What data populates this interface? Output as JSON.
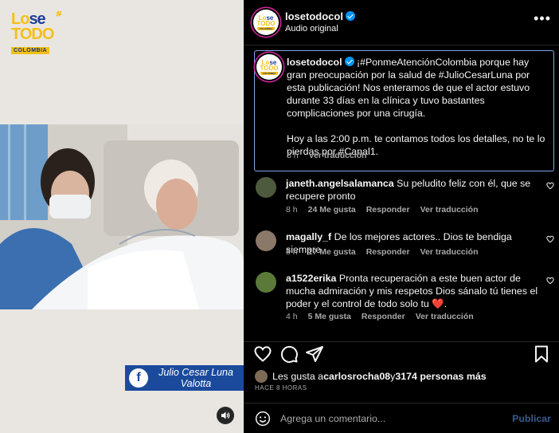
{
  "media": {
    "logo": {
      "lo": "Lo",
      "se": "se",
      "todo": "TODO",
      "country": "COLOMBIA"
    },
    "name_tag": {
      "line1": "Julio Cesar Luna",
      "line2": "Valotta"
    }
  },
  "header": {
    "username": "losetodocol",
    "audio": "Audio original"
  },
  "caption": {
    "username": "losetodocol",
    "paragraph1": " ¡#PonmeAtenciónColombia porque hay gran preocupación por la salud de #JulioCesarLuna por esta publicación! Nos enteramos de que el actor estuvo durante 33 días en la clínica y tuvo bastantes complicaciones por una cirugía.",
    "paragraph2": "Hoy a las 2:00 p.m. te contamos todos los detalles, no te lo pierdas por #Canal1.",
    "time": "8 h",
    "see_translation": "Ver traducción"
  },
  "comments": [
    {
      "username": "janeth.angelsalamanca",
      "text": " Su peludito feliz con él, que se recupere pronto",
      "time": "8 h",
      "likes": "24 Me gusta",
      "reply": "Responder",
      "translate": "Ver traducción"
    },
    {
      "username": "magally_f",
      "text": " De los mejores actores.. Dios te bendiga siempre",
      "time": "8 h",
      "likes": "17 Me gusta",
      "reply": "Responder",
      "translate": "Ver traducción"
    },
    {
      "username": "a1522erika",
      "text": " Pronta recuperación a este buen actor de mucha admiración y mis respetos Dios sánalo tú tienes el poder y el control de todo solo tu ❤️.",
      "time": "4 h",
      "likes": "5 Me gusta",
      "reply": "Responder",
      "translate": "Ver traducción"
    }
  ],
  "likes": {
    "prefix": "Les gusta a ",
    "user": "carlosrocha08",
    "middle": " y ",
    "count": "3174 personas más"
  },
  "timestamp": "HACE 8 HORAS",
  "add_comment": {
    "placeholder": "Agrega un comentario...",
    "publish": "Publicar"
  },
  "colors": {
    "accent": "#0095f6",
    "caption_border": "#7fa7ea",
    "name_tag_bg": "#1b4a9d",
    "logo_yellow": "#f3c01a",
    "logo_blue": "#1d3f9a"
  },
  "icons": [
    "heart-icon",
    "comment-icon",
    "share-icon",
    "bookmark-icon",
    "emoji-icon",
    "more-icon",
    "speaker-icon",
    "facebook-icon",
    "verified-icon"
  ]
}
